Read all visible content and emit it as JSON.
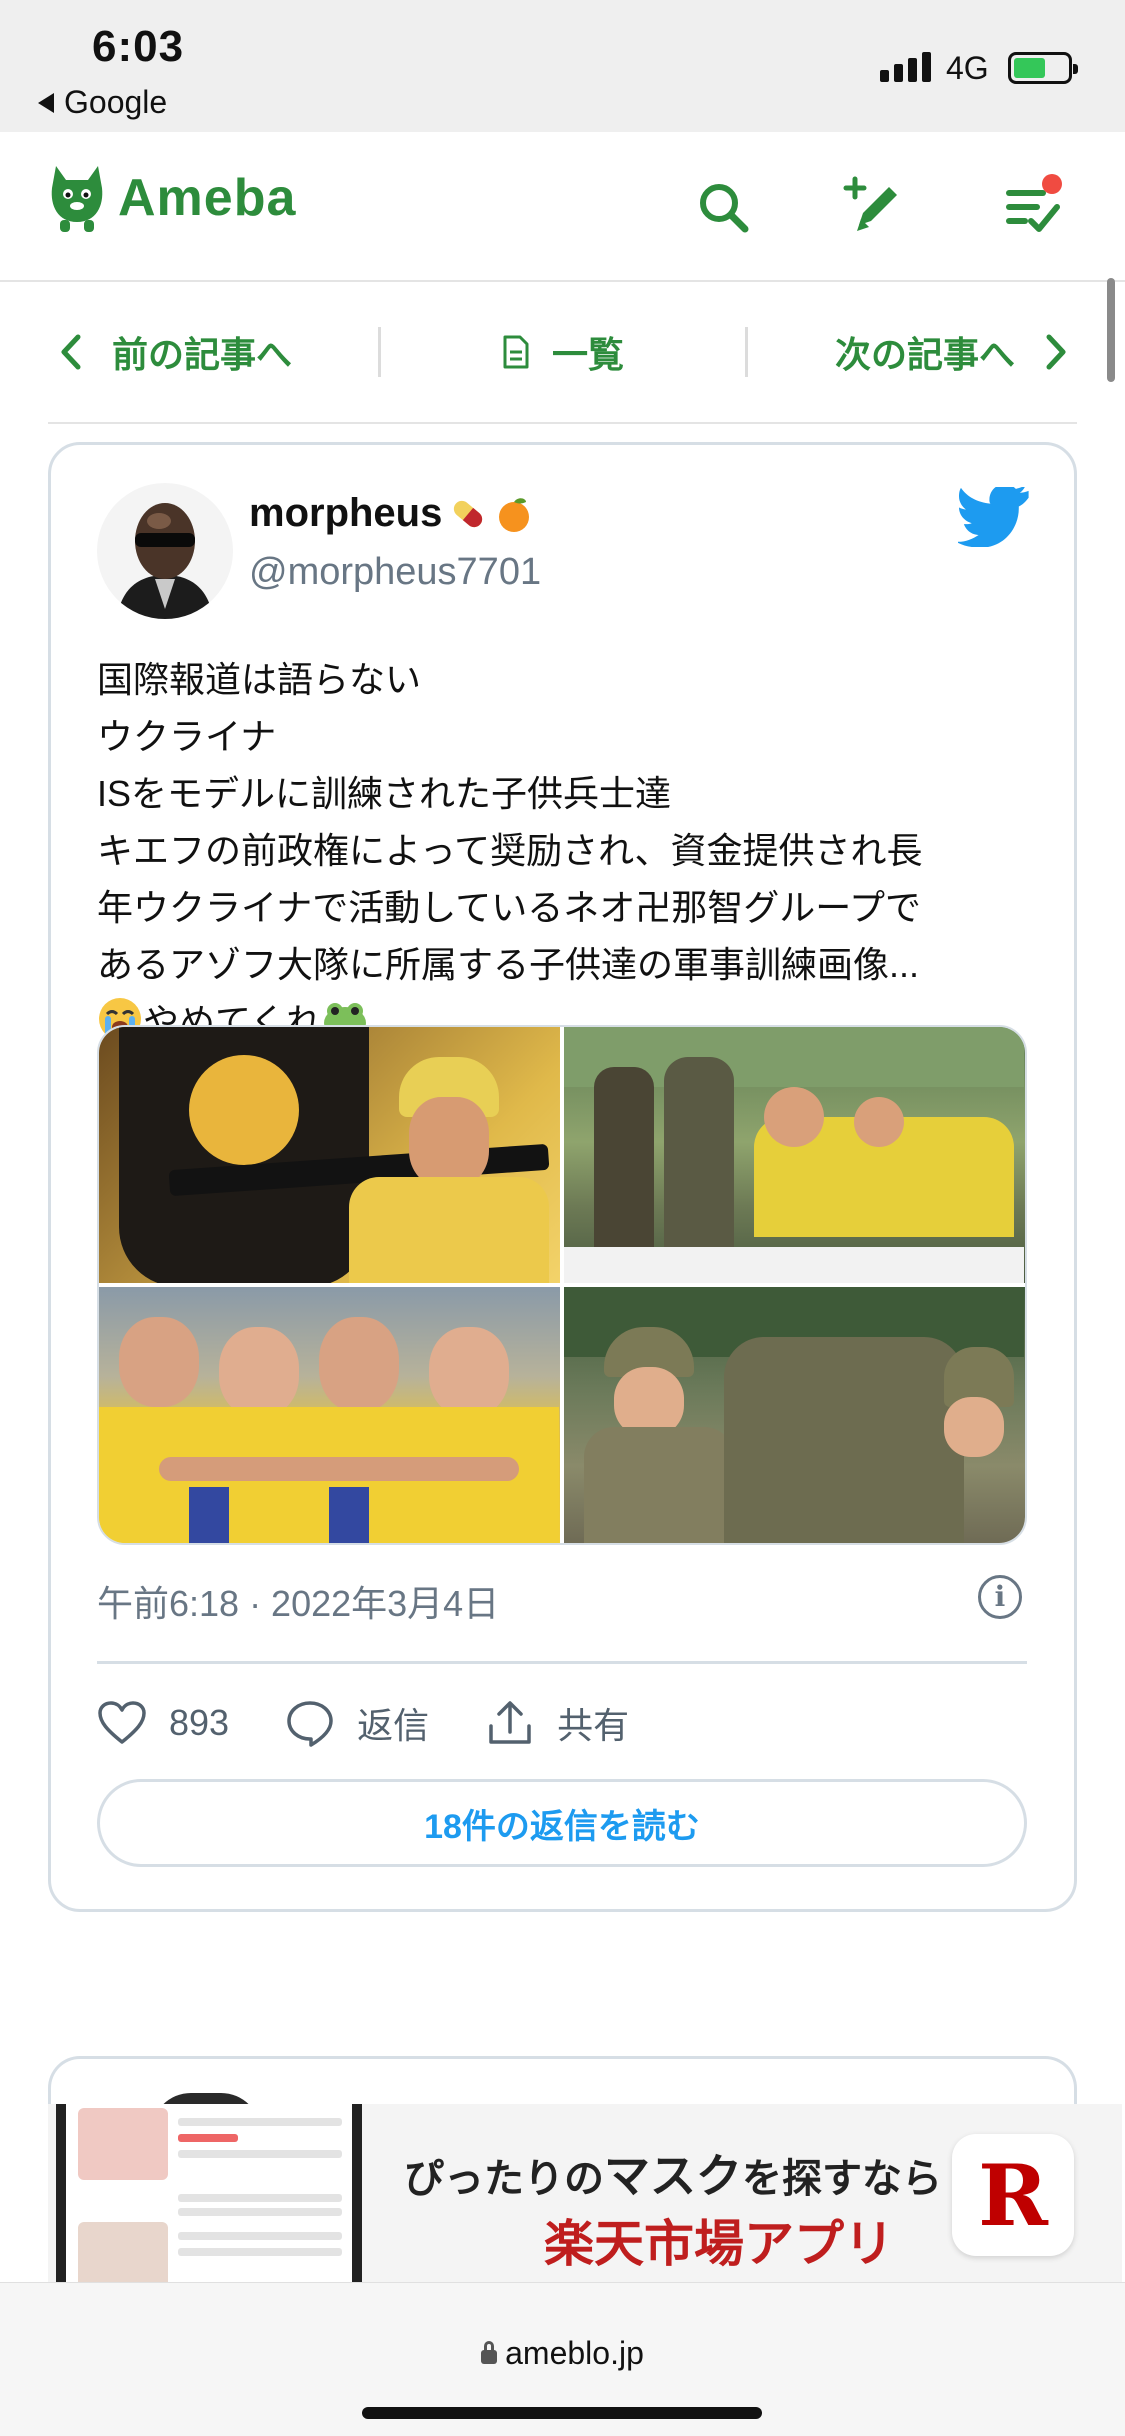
{
  "status_bar": {
    "time": "6:03",
    "back_app": "Google",
    "network": "4G"
  },
  "header": {
    "logo_text": "Ameba",
    "brand_color": "#2d8c3c",
    "notification_color": "#f04b41"
  },
  "article_nav": {
    "prev_label": "前の記事へ",
    "list_label": "一覧",
    "next_label": "次の記事へ"
  },
  "tweet": {
    "author_name": "morpheus",
    "author_handle": "@morpheus7701",
    "text_lines": [
      "国際報道は語らない",
      "ウクライナ",
      "ISをモデルに訓練された子供兵士達",
      "キエフの前政権によって奨励され、資金提供され長",
      "年ウクライナで活動しているネオ卍那智グループで",
      "あるアゾフ大隊に所属する子供達の軍事訓練画像...",
      "やめてくれ"
    ],
    "timestamp": "午前6:18 · 2022年3月4日",
    "like_count": "893",
    "reply_label": "返信",
    "share_label": "共有",
    "read_replies_label": "18件の返信を読む",
    "accent_color": "#1d9bf0"
  },
  "ad": {
    "line1_prefix": "ぴったりの",
    "line1_emph": "マスク",
    "line1_suffix": "を探すなら",
    "line2": "楽天市場アプリ",
    "logo_letter": "R",
    "brand_color": "#bf0000"
  },
  "browser": {
    "url": "ameblo.jp"
  }
}
